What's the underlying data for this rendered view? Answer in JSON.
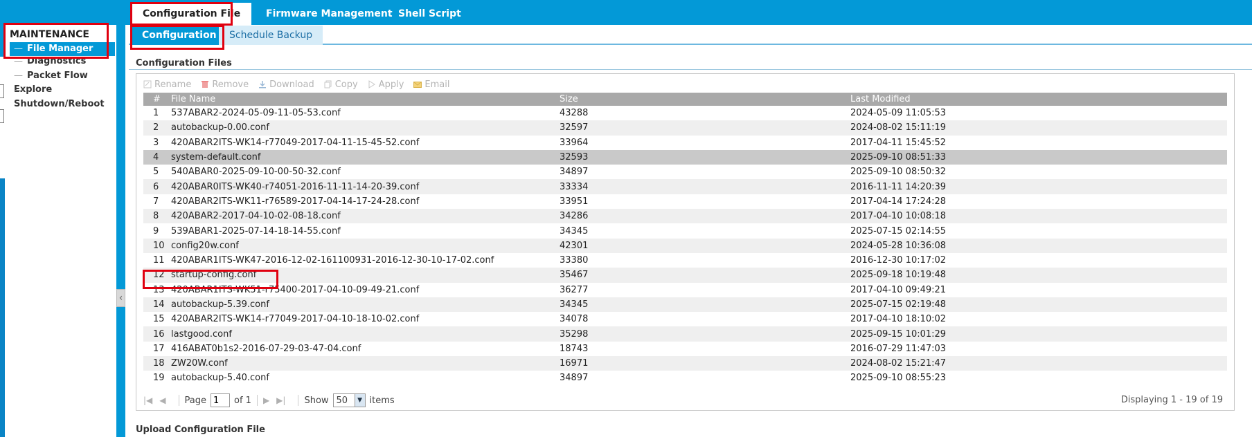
{
  "top_tabs": [
    {
      "label": "Configuration File"
    },
    {
      "label": "Firmware Management"
    },
    {
      "label": "Shell Script"
    }
  ],
  "sidebar": {
    "title": "MAINTENANCE",
    "items": [
      {
        "label": "File Manager",
        "active": true
      },
      {
        "label": "Diagnostics"
      },
      {
        "label": "Packet Flow Explore"
      },
      {
        "label": "Shutdown/Reboot"
      }
    ],
    "collapse_glyph": "‹"
  },
  "sub_tabs": [
    {
      "label": "Configuration"
    },
    {
      "label": "Schedule Backup"
    }
  ],
  "sections": {
    "config_files": "Configuration Files",
    "upload": "Upload Configuration File"
  },
  "toolbar": {
    "rename": "Rename",
    "remove": "Remove",
    "download": "Download",
    "copy": "Copy",
    "apply": "Apply",
    "email": "Email"
  },
  "grid": {
    "columns": [
      "#",
      "File Name",
      "Size",
      "Last Modified"
    ],
    "rows": [
      [
        "1",
        "537ABAR2-2024-05-09-11-05-53.conf",
        "43288",
        "2024-05-09 11:05:53"
      ],
      [
        "2",
        "autobackup-0.00.conf",
        "32597",
        "2024-08-02 15:11:19"
      ],
      [
        "3",
        "420ABAR2ITS-WK14-r77049-2017-04-11-15-45-52.conf",
        "33964",
        "2017-04-11 15:45:52"
      ],
      [
        "4",
        "system-default.conf",
        "32593",
        "2025-09-10 08:51:33"
      ],
      [
        "5",
        "540ABAR0-2025-09-10-00-50-32.conf",
        "34897",
        "2025-09-10 08:50:32"
      ],
      [
        "6",
        "420ABAR0ITS-WK40-r74051-2016-11-11-14-20-39.conf",
        "33334",
        "2016-11-11 14:20:39"
      ],
      [
        "7",
        "420ABAR2ITS-WK11-r76589-2017-04-14-17-24-28.conf",
        "33951",
        "2017-04-14 17:24:28"
      ],
      [
        "8",
        "420ABAR2-2017-04-10-02-08-18.conf",
        "34286",
        "2017-04-10 10:08:18"
      ],
      [
        "9",
        "539ABAR1-2025-07-14-18-14-55.conf",
        "34345",
        "2025-07-15 02:14:55"
      ],
      [
        "10",
        "config20w.conf",
        "42301",
        "2024-05-28 10:36:08"
      ],
      [
        "11",
        "420ABAR1ITS-WK47-2016-12-02-161100931-2016-12-30-10-17-02.conf",
        "33380",
        "2016-12-30 10:17:02"
      ],
      [
        "12",
        "startup-config.conf",
        "35467",
        "2025-09-18 10:19:48"
      ],
      [
        "13",
        "420ABAR1ITS-WK51-r75400-2017-04-10-09-49-21.conf",
        "36277",
        "2017-04-10 09:49:21"
      ],
      [
        "14",
        "autobackup-5.39.conf",
        "34345",
        "2025-07-15 02:19:48"
      ],
      [
        "15",
        "420ABAR2ITS-WK14-r77049-2017-04-10-18-10-02.conf",
        "34078",
        "2017-04-10 18:10:02"
      ],
      [
        "16",
        "lastgood.conf",
        "35298",
        "2025-09-15 10:01:29"
      ],
      [
        "17",
        "416ABAT0b1s2-2016-07-29-03-47-04.conf",
        "18743",
        "2016-07-29 11:47:03"
      ],
      [
        "18",
        "ZW20W.conf",
        "16971",
        "2024-08-02 15:21:47"
      ],
      [
        "19",
        "autobackup-5.40.conf",
        "34897",
        "2025-09-10 08:55:23"
      ]
    ],
    "selected_row": 4
  },
  "pager": {
    "page_label": "Page",
    "page_value": "1",
    "of_label": "of 1",
    "show_label": "Show",
    "per_page": "50",
    "items_label": "items",
    "display_text": "Displaying 1 - 19 of 19"
  },
  "colors": {
    "accent": "#0399d7",
    "highlight": "#e0000f",
    "header_gray": "#a9a9a9"
  }
}
